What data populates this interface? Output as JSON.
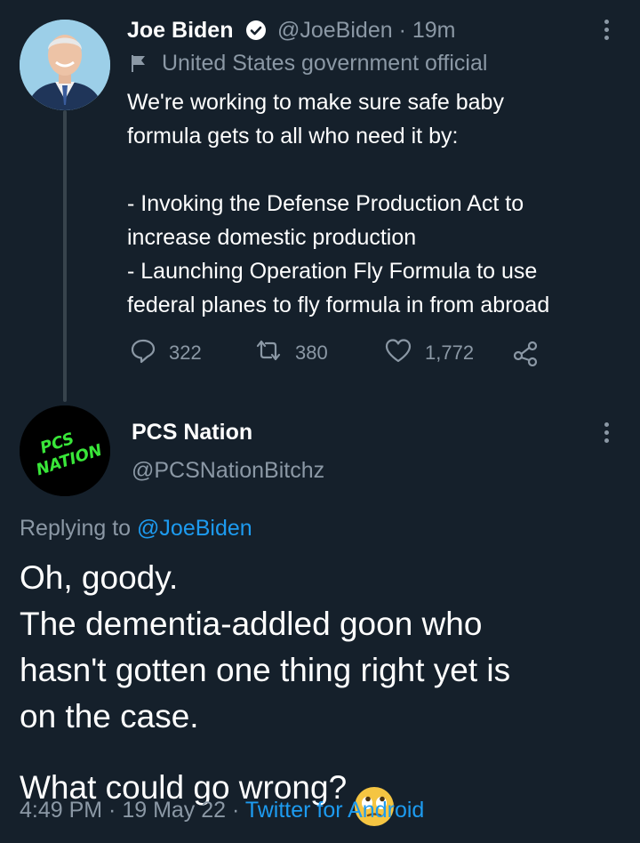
{
  "tweet": {
    "author_name": "Joe Biden",
    "handle": "@JoeBiden",
    "separator": "·",
    "time_ago": "19m",
    "label": "United States government official",
    "text": "We're working to make sure safe baby\nformula gets to all who need it by:\n\n- Invoking the Defense Production Act to\nincrease domestic production\n- Launching Operation Fly Formula to use\nfederal planes to fly formula in from abroad",
    "replies": "322",
    "retweets": "380",
    "likes": "1,772",
    "icons": [
      "verified-badge-icon",
      "flag-icon",
      "more-icon",
      "reply-icon",
      "retweet-icon",
      "like-icon",
      "share-icon"
    ]
  },
  "reply": {
    "author_name": "PCS Nation",
    "handle": "@PCSNationBitchz",
    "avatar_text_line1": "PCS",
    "avatar_text_line2": "NATION",
    "replying_prefix": "Replying to",
    "replying_to": "@JoeBiden",
    "text": "Oh, goody.\nThe dementia-addled goon who\nhasn't gotten one thing right yet is\non the case.\nWhat could go wrong?",
    "emoji": "face-with-rolling-eyes",
    "timestamp": "4:49 PM · 19 May 22 ·",
    "source": "Twitter for Android"
  },
  "colors": {
    "background": "#15202b",
    "text": "#ffffff",
    "secondary": "#8b98a5",
    "link": "#1d9bf0",
    "thread_line": "#38444d",
    "logo_green": "#39e639"
  }
}
